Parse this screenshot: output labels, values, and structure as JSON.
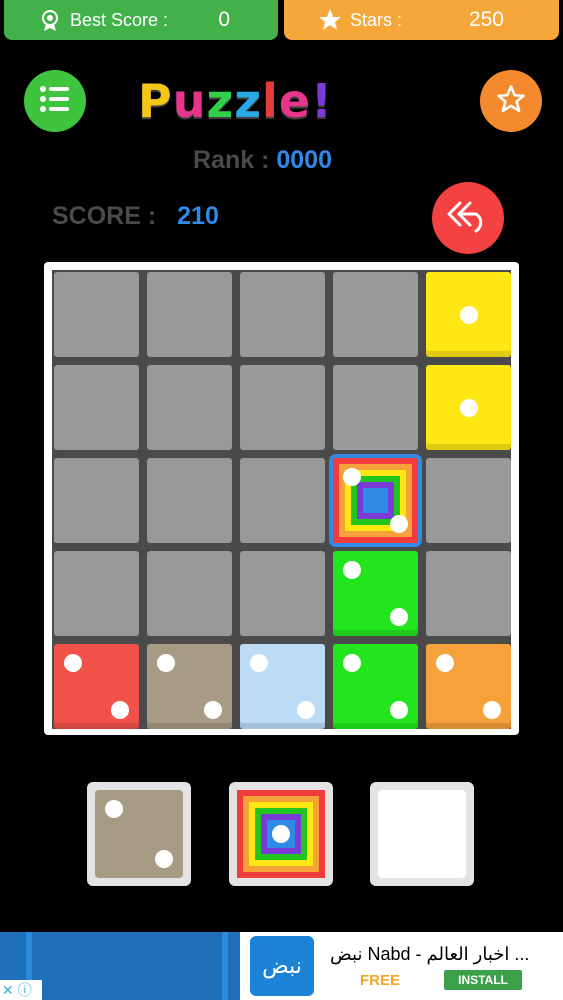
{
  "header": {
    "best_score_label": "Best Score :",
    "best_score_value": "0",
    "stars_label": "Stars :",
    "stars_value": "250"
  },
  "title": {
    "letters": [
      "P",
      "u",
      "z",
      "z",
      "l",
      "e",
      "!"
    ],
    "colors": [
      "#f5c518",
      "#e8358c",
      "#2fd14a",
      "#2aa8e8",
      "#e53b3b",
      "#e8358c",
      "#7a3bd6"
    ]
  },
  "rank": {
    "label": "Rank :",
    "value": "0000"
  },
  "score": {
    "label": "SCORE :",
    "value": "210"
  },
  "icons": {
    "menu": "list-icon",
    "star": "star-icon",
    "undo": "undo-icon",
    "medal": "medal-icon"
  },
  "board": {
    "rows": 5,
    "cols": 5,
    "empty_color": "#999999",
    "tiles": [
      {
        "row": 0,
        "col": 4,
        "color": "#ffe713",
        "pips": 1
      },
      {
        "row": 1,
        "col": 4,
        "color": "#ffe713",
        "pips": 1
      },
      {
        "row": 2,
        "col": 3,
        "color": "rainbow",
        "pips": 2,
        "selected": true
      },
      {
        "row": 3,
        "col": 3,
        "color": "#22e51e",
        "pips": 2
      },
      {
        "row": 4,
        "col": 0,
        "color": "#f2514a",
        "pips": 2
      },
      {
        "row": 4,
        "col": 1,
        "color": "#a89b85",
        "pips": 2
      },
      {
        "row": 4,
        "col": 2,
        "color": "#bcdcf5",
        "pips": 2
      },
      {
        "row": 4,
        "col": 3,
        "color": "#22e51e",
        "pips": 2
      },
      {
        "row": 4,
        "col": 4,
        "color": "#f7a13a",
        "pips": 2
      }
    ]
  },
  "tray": [
    {
      "color": "#a89b85",
      "pips": 2
    },
    {
      "color": "rainbow",
      "pips": 1
    },
    {
      "color": "#ffffff",
      "pips": 0
    }
  ],
  "ad": {
    "title": "نبض Nabd - اخبار العالم ...",
    "logo_text": "نبض",
    "free_label": "FREE",
    "install_label": "INSTALL"
  }
}
